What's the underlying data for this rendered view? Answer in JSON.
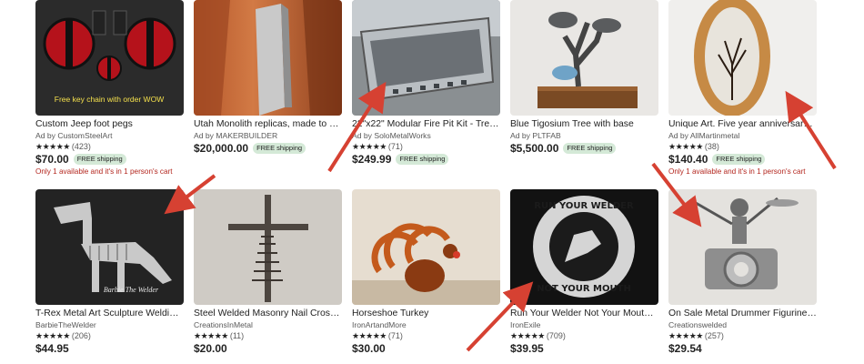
{
  "colors": {
    "star": "#222222",
    "shipping_bg": "#d4e9d7",
    "stock_text": "#b3261e",
    "arrow": "#d64132"
  },
  "listings": [
    {
      "title": "Custom Jeep foot pegs",
      "shop": "Ad by CustomSteelArt",
      "stars": "★★★★★",
      "reviews": "(423)",
      "price": "$70.00",
      "shipping": "FREE shipping",
      "stock": "Only 1 available and it's in 1 person's cart",
      "image_text": "Free key chain with order WOW",
      "image_icon": "deadpool-pegs-icon"
    },
    {
      "title": "Utah Monolith replicas, made to or...",
      "shop": "Ad by MAKERBUILDER",
      "stars": "",
      "reviews": "",
      "price": "$20,000.00",
      "shipping": "FREE shipping",
      "stock": "",
      "image_icon": "monolith-icon"
    },
    {
      "title": "22\"x22\" Modular Fire Pit Kit - Tree T...",
      "shop": "Ad by SoloMetalWorks",
      "stars": "★★★★★",
      "reviews": "(71)",
      "price": "$249.99",
      "shipping": "FREE shipping",
      "stock": "",
      "image_icon": "fire-pit-icon"
    },
    {
      "title": "Blue Tigosium Tree with base",
      "shop": "Ad by PLTFAB",
      "stars": "",
      "reviews": "",
      "price": "$5,500.00",
      "shipping": "FREE shipping",
      "stock": "",
      "image_icon": "metal-tree-icon"
    },
    {
      "title": "Unique Art. Five year anniversary ...",
      "shop": "Ad by AllMartinmetal",
      "stars": "★★★★★",
      "reviews": "(38)",
      "price": "$140.40",
      "shipping": "FREE shipping",
      "stock": "Only 1 available and it's in 1 person's cart",
      "image_icon": "wood-slice-art-icon"
    },
    {
      "title": "T-Rex Metal Art Sculpture Welding ...",
      "shop": "BarbieTheWelder",
      "stars": "★★★★★",
      "reviews": "(206)",
      "price": "$44.95",
      "shipping": "",
      "stock": "",
      "image_text": "Barbie The Welder",
      "image_icon": "trex-sculpture-icon"
    },
    {
      "title": "Steel Welded Masonry Nail Cross - ...",
      "shop": "CreationsInMetal",
      "stars": "★★★★★",
      "reviews": "(11)",
      "price": "$20.00",
      "shipping": "",
      "stock": "",
      "image_icon": "nail-cross-icon"
    },
    {
      "title": "Horseshoe Turkey",
      "shop": "IronArtandMore",
      "stars": "★★★★★",
      "reviews": "(71)",
      "price": "$30.00",
      "shipping": "",
      "stock": "",
      "image_icon": "horseshoe-turkey-icon"
    },
    {
      "title": "Run Your Welder Not Your Mouth G...",
      "shop": "IronExile",
      "stars": "★★★★★",
      "reviews": "(709)",
      "price": "$39.95",
      "shipping": "",
      "stock": "",
      "image_text_top": "RUN YOUR WELDER",
      "image_text_bottom": "NOT YOUR MOUTH",
      "image_icon": "welder-sign-icon"
    },
    {
      "title": "On Sale Metal Drummer Figurine, D...",
      "shop": "Creationswelded",
      "stars": "★★★★★",
      "reviews": "(257)",
      "price": "$29.54",
      "shipping": "",
      "stock": "",
      "image_icon": "drummer-figurine-icon"
    }
  ]
}
